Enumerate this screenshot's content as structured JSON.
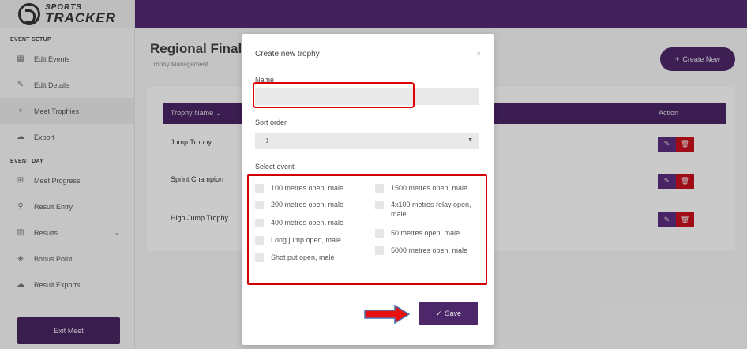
{
  "app": {
    "logo_line1": "SPORTS",
    "logo_line2": "TRACKER"
  },
  "sidebar": {
    "section1": "EVENT SETUP",
    "setup_items": [
      {
        "label": "Edit Events",
        "icon": "calendar-icon"
      },
      {
        "label": "Edit Details",
        "icon": "edit-icon"
      },
      {
        "label": "Meet Trophies",
        "icon": "trophy-icon"
      },
      {
        "label": "Export",
        "icon": "cloud-icon"
      }
    ],
    "section2": "EVENT DAY",
    "day_items": [
      {
        "label": "Meet Progress",
        "icon": "grid-icon"
      },
      {
        "label": "Result Entry",
        "icon": "search-icon"
      },
      {
        "label": "Results",
        "icon": "bar-chart-icon"
      },
      {
        "label": "Bonus Point",
        "icon": "gem-icon"
      },
      {
        "label": "Result Exports",
        "icon": "cloud-icon"
      }
    ],
    "exit_label": "Exit Meet"
  },
  "main": {
    "title": "Regional Finals",
    "subtitle": "Trophy Management",
    "create_label": "Create New",
    "table": {
      "col_name": "Trophy Name",
      "col_action": "Action",
      "rows": [
        {
          "name": "Jump Trophy"
        },
        {
          "name": "Sprint Champion"
        },
        {
          "name": "High Jump Trophy"
        }
      ]
    }
  },
  "modal": {
    "title": "Create new trophy",
    "close": "×",
    "name_label": "Name",
    "name_value": "",
    "sort_label": "Sort order",
    "sort_value": "1",
    "event_label": "Select event",
    "events_left": [
      "100 metres open, male",
      "200 metres open, male",
      "400 metres open, male",
      "Long jump open, male",
      "Shot put open, male"
    ],
    "events_right": [
      "1500 metres open, male",
      "4x100 metres relay open, male",
      "50 metres open, male",
      "5000 metres open, male"
    ],
    "save_label": "Save"
  },
  "colors": {
    "brand_purple": "#52296f",
    "danger_red": "#c4111b",
    "annotation_red": "#e00000"
  }
}
